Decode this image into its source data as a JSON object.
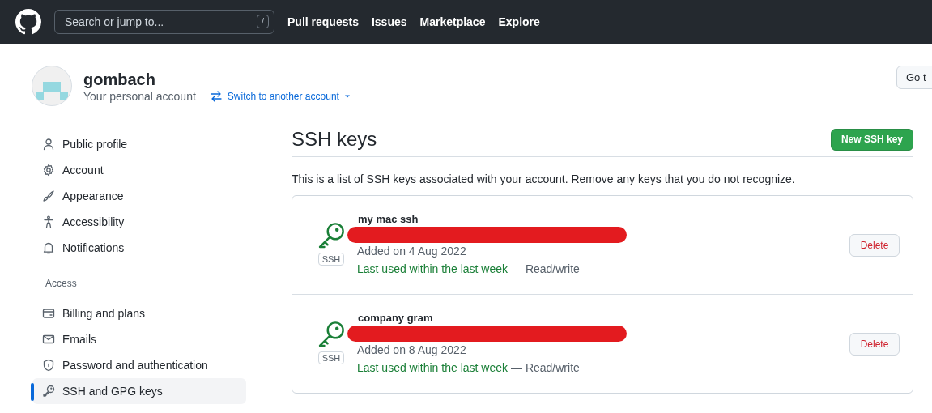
{
  "header": {
    "search": {
      "placeholder": "Search or jump to...",
      "shortcut": "/"
    },
    "nav": [
      "Pull requests",
      "Issues",
      "Marketplace",
      "Explore"
    ]
  },
  "account": {
    "username": "gombach",
    "subtitle": "Your personal account",
    "switch_link": "Switch to another account",
    "go_button": "Go t"
  },
  "sidebar": {
    "groups": [
      {
        "items": [
          {
            "label": "Public profile",
            "selected": false
          },
          {
            "label": "Account",
            "selected": false
          },
          {
            "label": "Appearance",
            "selected": false
          },
          {
            "label": "Accessibility",
            "selected": false
          },
          {
            "label": "Notifications",
            "selected": false
          }
        ]
      },
      {
        "heading": "Access",
        "items": [
          {
            "label": "Billing and plans",
            "selected": false
          },
          {
            "label": "Emails",
            "selected": false
          },
          {
            "label": "Password and authentication",
            "selected": false
          },
          {
            "label": "SSH and GPG keys",
            "selected": true
          }
        ]
      }
    ]
  },
  "main": {
    "title": "SSH keys",
    "new_button": "New SSH key",
    "description": "This is a list of SSH keys associated with your account. Remove any keys that you do not recognize.",
    "keys": [
      {
        "name": "my mac ssh",
        "type_badge": "SSH",
        "added": "Added on 4 Aug 2022",
        "last_used": "Last used within the last week",
        "access": "— Read/write",
        "delete_button": "Delete"
      },
      {
        "name": "company gram",
        "type_badge": "SSH",
        "added": "Added on 8 Aug 2022",
        "last_used": "Last used within the last week",
        "access": "— Read/write",
        "delete_button": "Delete"
      }
    ]
  }
}
